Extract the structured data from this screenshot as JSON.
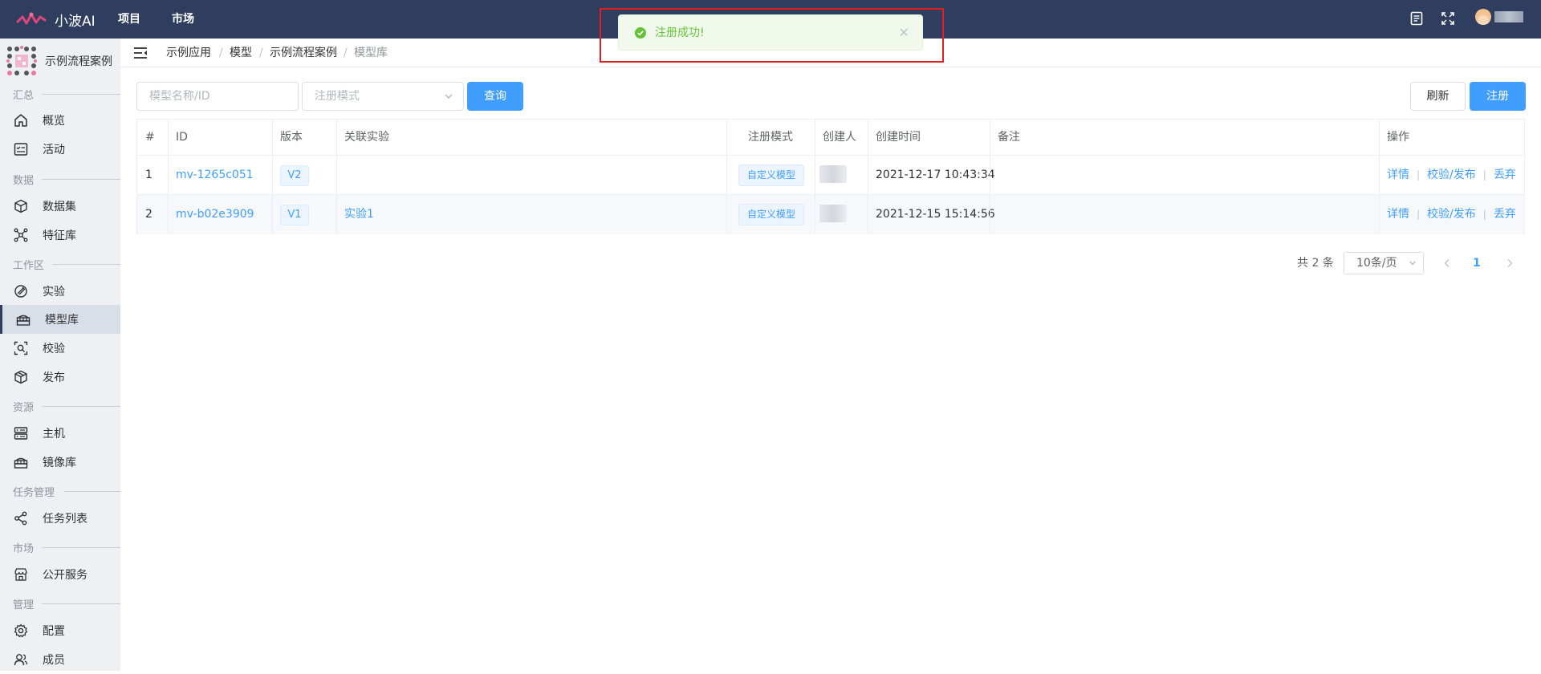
{
  "app": {
    "name": "小波AI",
    "nav": [
      "项目",
      "市场"
    ]
  },
  "sidebar": {
    "project_name": "示例流程案例",
    "groups": [
      {
        "label": "汇总",
        "items": [
          "概览",
          "活动"
        ]
      },
      {
        "label": "数据",
        "items": [
          "数据集",
          "特征库"
        ]
      },
      {
        "label": "工作区",
        "items": [
          "实验",
          "模型库",
          "校验",
          "发布"
        ]
      },
      {
        "label": "资源",
        "items": [
          "主机",
          "镜像库"
        ]
      },
      {
        "label": "任务管理",
        "items": [
          "任务列表"
        ]
      },
      {
        "label": "市场",
        "items": [
          "公开服务"
        ]
      },
      {
        "label": "管理",
        "items": [
          "配置",
          "成员"
        ]
      }
    ],
    "active_item": "模型库"
  },
  "breadcrumb": [
    "示例应用",
    "模型",
    "示例流程案例",
    "模型库"
  ],
  "filters": {
    "name_placeholder": "模型名称/ID",
    "mode_placeholder": "注册模式",
    "query_label": "查询",
    "refresh_label": "刷新",
    "register_label": "注册"
  },
  "table": {
    "headers": [
      "#",
      "ID",
      "版本",
      "关联实验",
      "注册模式",
      "创建人",
      "创建时间",
      "备注",
      "操作"
    ],
    "rows": [
      {
        "index": "1",
        "id": "mv-1265c051",
        "version": "V2",
        "experiment": "",
        "mode": "自定义模型",
        "created": "2021-12-17 10:43:34",
        "note": ""
      },
      {
        "index": "2",
        "id": "mv-b02e3909",
        "version": "V1",
        "experiment": "实验1",
        "mode": "自定义模型",
        "created": "2021-12-15 15:14:56",
        "note": ""
      }
    ],
    "actions": [
      "详情",
      "校验/发布",
      "丢弃"
    ]
  },
  "pagination": {
    "total": "共 2 条",
    "page_size": "10条/页",
    "current": "1"
  },
  "toast": {
    "message": "注册成功!",
    "type": "success"
  },
  "colors": {
    "topbar": "#2f3e5e",
    "primary": "#409eff",
    "success": "#67c23a",
    "annotation": "#e02020"
  }
}
